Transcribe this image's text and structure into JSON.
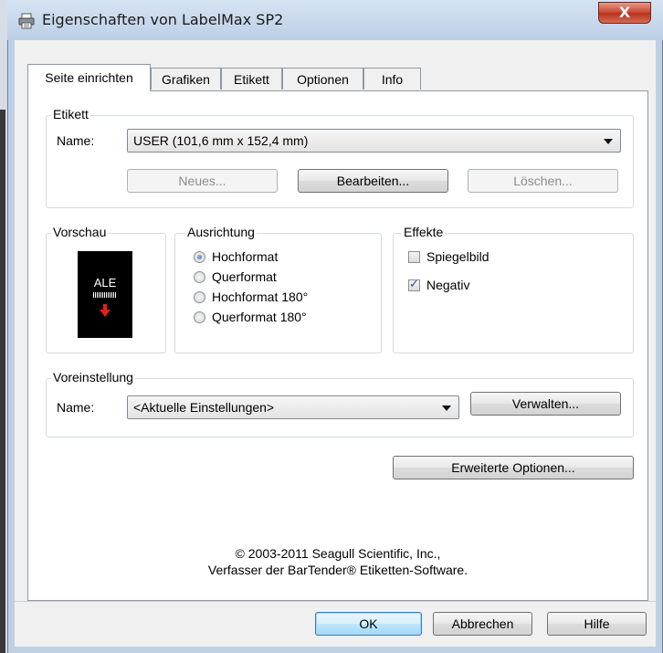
{
  "window": {
    "title": "Eigenschaften von LabelMax SP2",
    "close_label": "X"
  },
  "tabs": [
    {
      "label": "Seite einrichten",
      "active": true
    },
    {
      "label": "Grafiken",
      "active": false
    },
    {
      "label": "Etikett",
      "active": false
    },
    {
      "label": "Optionen",
      "active": false
    },
    {
      "label": "Info",
      "active": false
    }
  ],
  "etikett": {
    "group_label": "Etikett",
    "name_label": "Name:",
    "name_value": "USER (101,6 mm x 152,4 mm)",
    "new_button": "Neues...",
    "edit_button": "Bearbeiten...",
    "delete_button": "Löschen..."
  },
  "vorschau": {
    "group_label": "Vorschau",
    "preview_text": "ALE"
  },
  "ausrichtung": {
    "group_label": "Ausrichtung",
    "options": [
      {
        "label": "Hochformat",
        "checked": true
      },
      {
        "label": "Querformat",
        "checked": false
      },
      {
        "label": "Hochformat 180°",
        "checked": false
      },
      {
        "label": "Querformat 180°",
        "checked": false
      }
    ]
  },
  "effekte": {
    "group_label": "Effekte",
    "mirror_label": "Spiegelbild",
    "mirror_checked": false,
    "negative_label": "Negativ",
    "negative_checked": true
  },
  "voreinstellung": {
    "group_label": "Voreinstellung",
    "name_label": "Name:",
    "name_value": "<Aktuelle Einstellungen>",
    "manage_button": "Verwalten..."
  },
  "advanced_button": "Erweiterte Optionen...",
  "copyright": {
    "line1": "© 2003-2011 Seagull Scientific, Inc.,",
    "line2": "Verfasser der BarTender® Etiketten-Software."
  },
  "footer": {
    "ok": "OK",
    "cancel": "Abbrechen",
    "help": "Hilfe"
  },
  "colors": {
    "preview_arrow": "#e32119",
    "radio_dot": "#2a5c98",
    "checkmark": "#1f4f8f"
  }
}
